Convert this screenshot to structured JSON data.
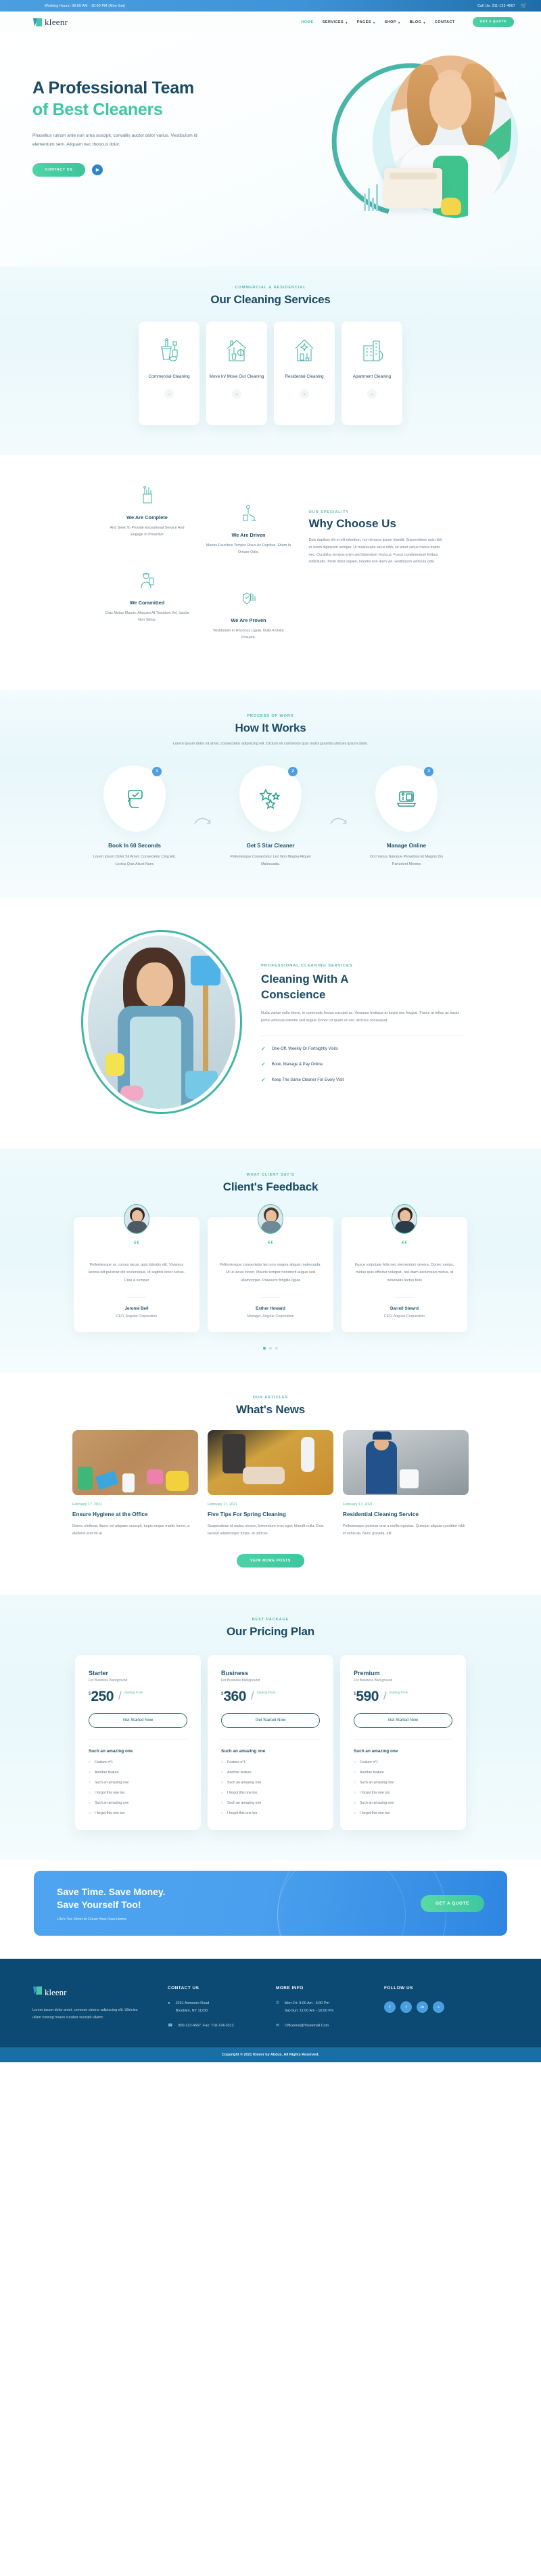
{
  "topbar": {
    "hours": "Working Hours: 08:00 AM - 10:00 PM (Mon-Sat)",
    "phone": "Call Us: 311-123-4567",
    "cart_icon": "cart-icon"
  },
  "nav": {
    "brand": "kleenr",
    "links": [
      {
        "label": "HOME",
        "caret": false
      },
      {
        "label": "SERVICES",
        "caret": true
      },
      {
        "label": "PAGES",
        "caret": true
      },
      {
        "label": "SHOP",
        "caret": true
      },
      {
        "label": "BLOG",
        "caret": true
      },
      {
        "label": "CONTACT",
        "caret": false
      }
    ],
    "quote_button": "GET A QUOTE"
  },
  "hero": {
    "title_line1": "A Professional Team",
    "title_line2": "of Best Cleaners",
    "paragraph": "Phasellus rutrum ante non urna suscipit, convallis auctor dolor varius. Vestibulum id elementum sem. Aliquam nec rhoncus dolor.",
    "contact_button": "CONTACT US",
    "play_icon": "play-icon"
  },
  "services": {
    "eyebrow": "COMMERCIAL & RESIDENCIAL",
    "title": "Our Cleaning Services",
    "cards": [
      {
        "name": "Commercial Cleaning",
        "icon": "supplies-bucket-icon",
        "arrow": "arrow-right-icon"
      },
      {
        "name": "Move In/ Move Out Cleaning",
        "icon": "house-broom-icon",
        "arrow": "arrow-right-icon"
      },
      {
        "name": "Residental Cleaning",
        "icon": "house-sparkle-icon",
        "arrow": "arrow-right-icon"
      },
      {
        "name": "Apartment Cleaning",
        "icon": "apartment-building-icon",
        "arrow": "arrow-right-icon"
      }
    ]
  },
  "why": {
    "eyebrow": "OUR SPECIALITY",
    "title": "Why Choose Us",
    "paragraph": "Duis dapibus elit ut elit interdum, non tempus ipsum blandit. Suspendisse quis nibh et lorem dignissim semper. Ut malesuada lacus nibh, sit amet varius metus mattis nec. Curabitur tempus enim sed bibendum rhoncus. Fusce condimentum finibus sollicitudin. Proin dolor sapien, lobortis non diam vel, vestibulum vehicula odio.",
    "items": [
      {
        "title": "We Are Complete",
        "text": "And Seek To Provide Exceptional Service And Engage In Proactive",
        "icon": "cleaning-tools-icon"
      },
      {
        "title": "We Are Driven",
        "text": "Mauris Faucibus Tempor Risus Ac Dapibus. Etiam In Ornare Odio.",
        "icon": "vacuum-icon"
      },
      {
        "title": "We Committed",
        "text": "Cras Metus Mauris, Aliquam At Tincidunt Vel, Iaculis Non Tellus.",
        "icon": "worker-phone-icon"
      },
      {
        "title": "We Are Proven",
        "text": "Vestibulum In Rhoncus Ligula. Nulla A Dolor Posuere.",
        "icon": "shield-hand-icon"
      }
    ]
  },
  "how": {
    "eyebrow": "PROCESS OF WORK",
    "title": "How It Works",
    "subtitle": "Lorem ipsum dolor sit amet, consectetur adipiscing elit. Dictum mi commodo quis morbi gravida ultricies ipsum diam.",
    "steps": [
      {
        "num": "1",
        "title": "Book In 60 Seconds",
        "text": "Lorem Ipsum Dolor Sit Amet, Consectetur Cing Elit. Luctus Quis Aliuet Nunc",
        "icon": "click-check-icon"
      },
      {
        "num": "2",
        "title": "Get 5 Star Cleaner",
        "text": "Pellentesque Consectetur Leo Non Magna Aliquet Malesuada.",
        "icon": "stars-icon"
      },
      {
        "num": "3",
        "title": "Manage Online",
        "text": "Orci Varius Natoque Penatibus Et Magnis Dis Parturient Montes",
        "icon": "laptop-manage-icon"
      }
    ],
    "arrow_icon": "curved-arrow-icon"
  },
  "conscience": {
    "eyebrow": "PROFESSIONAL CLEANING SERVICES",
    "title_line1": "Cleaning With A",
    "title_line2": "Conscience",
    "paragraph": "Nulla varius nulla libero, in commodo lectus suscipit ac. Vivamus tristique at turpis nec feugiat. Fusce at tellus ac turpis porta vehicula lobortis sed augue.Donec ut quam et orci ultricies consequat.",
    "features": [
      "One-Off, Weekly Or Fortnightly Visits",
      "Book, Manage & Pay Online",
      "Keep The Same Cleaner For Every Visit"
    ],
    "check_icon": "check-icon",
    "photo": "cleaner-woman-photo"
  },
  "feedback": {
    "eyebrow": "WHAT CLIENT SAY'S",
    "title": "Client's Feedback",
    "cards": [
      {
        "text": "Pellentesque ac cursus lacus, quis lobortis elit. Vivamus lacinia elit pulvinar elit scelerisque, id sagittis dolor luctus. Cras a semper",
        "name": "Jerome Bell",
        "role": "CEO, Angular Corporation",
        "avatar": "avatar-jerome"
      },
      {
        "text": "Pellentesque consectetur leo non magna aliquet malesuada. Ut ut lacus lorem. Mauris tempor hendrerit augue sed ullamcorper. Praesent fringilla ligula",
        "name": "Esther Howard",
        "role": "Manager, Angular Corporation",
        "avatar": "avatar-esther"
      },
      {
        "text": "Fusce vulputate felis nec elementum viverra. Donec varius, metus quis efficitur volutpat, nisl diam accumsan metus, id venenatis lectus felis",
        "name": "Darrell Stewrd",
        "role": "CEO, Angular Corporation",
        "avatar": "avatar-darrell"
      }
    ],
    "quote_icon": "quote-icon",
    "active_dot": 0
  },
  "news": {
    "eyebrow": "OUR ARTICLES",
    "title": "What's News",
    "posts": [
      {
        "date": "February 17, 2021",
        "title": "Ensure Hygiene at the Office",
        "excerpt": "Donec eleifend, libero vel aliquam suscipit, turpis neque mattis lorem, a eleifend erat mi at",
        "image": "cleaning-supplies-flatlay"
      },
      {
        "date": "February 17, 2021",
        "title": "Five Tips For Spring Cleaning",
        "excerpt": "Suspendisse id metus ornare, fermentum eros eget, blandit nulla. Duis laoreet ullamcorper turpis, at ultrices",
        "image": "mopping-floor-photo"
      },
      {
        "date": "February 17, 2021",
        "title": "Residential Cleaning Service",
        "excerpt": "Pellentesque pulvinar erat a mollis egestas. Quisque aliquam porttitor nibh id vehicula. Nunc gravida, elit",
        "image": "cleaner-with-bucket-photo"
      }
    ],
    "more_button": "VEIW MORE POSTS"
  },
  "pricing": {
    "eyebrow": "BEST PACKAGE",
    "title": "Our Pricing Plan",
    "plans": [
      {
        "name": "Starter",
        "for": "For Business Background",
        "currency": "$",
        "price": "250",
        "from": "Starting From",
        "button": "Get Started Now",
        "features_heading": "Such an amazing one",
        "features": [
          "Feature n°1",
          "Another feature",
          "Such an amazing one",
          "I forgot this one too",
          "Such an amazing one",
          "I forgot this one too"
        ]
      },
      {
        "name": "Business",
        "for": "For Business Background",
        "currency": "$",
        "price": "360",
        "from": "Starting From",
        "button": "Get Started Now",
        "features_heading": "Such an amazing one",
        "features": [
          "Feature n°1",
          "Another feature",
          "Such an amazing one",
          "I forgot this one too",
          "Such an amazing one",
          "I forgot this one too"
        ]
      },
      {
        "name": "Premium",
        "for": "For Business Background",
        "currency": "$",
        "price": "590",
        "from": "Starting From",
        "button": "Get Started Now",
        "features_heading": "Such an amazing one",
        "features": [
          "Feature n°1",
          "Another feature",
          "Such an amazing one",
          "I forgot this one too",
          "Such an amazing one",
          "I forgot this one too"
        ]
      }
    ]
  },
  "cta": {
    "line1": "Save Time. Save Money.",
    "line2": "Save Yourself Too!",
    "sub": "Life's Too Short to Clean Your Own Home",
    "button": "GET A QUOTE"
  },
  "footer": {
    "brand": "kleenr",
    "about": "Lorem ipsum dolor amet, cevonse cteerur adipiscing elit. Ultricies ullam cowreg noasn curabur suscipit ullamc",
    "contact_heading": "CONTACT US",
    "address_line1": "3261 Anmoore Road",
    "address_line2": "Brooklyn, NY 11230",
    "phone": "800-123-4567, Fax: 718-724-3312",
    "info_heading": "MORE INFO",
    "hours_line1": "Mon-Fri: 9:00 Am - 5:00 Pm",
    "hours_line2": "Sat-Sun: 11:00 Am - 16:00 Pm",
    "email": "Officeone@Youremail.Com",
    "follow_heading": "FOLLOW US",
    "socials": [
      {
        "name": "facebook-icon",
        "glyph": "f"
      },
      {
        "name": "twitter-icon",
        "glyph": "t"
      },
      {
        "name": "linkedin-icon",
        "glyph": "in"
      },
      {
        "name": "skype-icon",
        "glyph": "s"
      }
    ],
    "copyright": "Copyright © 2021 Kleenr by Abdus. All Rights Reserved."
  },
  "colors": {
    "brand_teal": "#3ec79f",
    "deep_blue": "#1b4a63",
    "footer_bg": "#0d4a73",
    "accent_blue": "#4a9fe0"
  }
}
